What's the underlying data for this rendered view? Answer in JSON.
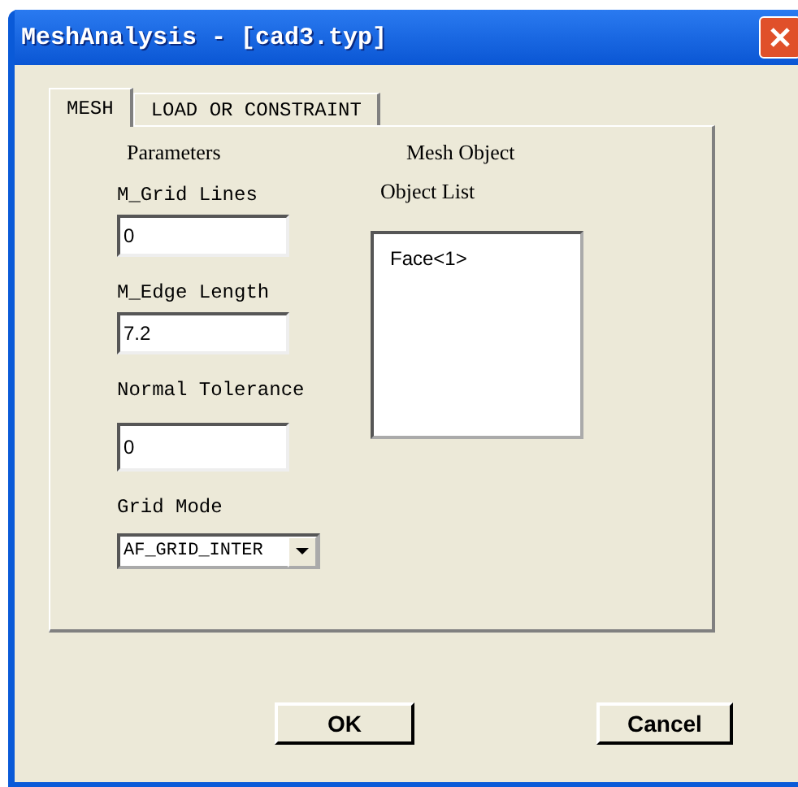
{
  "window": {
    "title": "MeshAnalysis - [cad3.typ]"
  },
  "tabs": [
    {
      "label": "MESH",
      "selected": true
    },
    {
      "label": "LOAD OR CONSTRAINT",
      "selected": false
    }
  ],
  "parameters": {
    "heading": "Parameters",
    "fields": [
      {
        "label": "M_Grid Lines",
        "value": "0"
      },
      {
        "label": "M_Edge Length",
        "value": "7.2"
      },
      {
        "label": "Normal Tolerance",
        "value": "0"
      }
    ],
    "grid_mode": {
      "label": "Grid Mode",
      "value": "AF_GRID_INTER"
    }
  },
  "mesh_object": {
    "heading": "Mesh Object",
    "list_label": "Object List",
    "items": [
      {
        "label": "Face<1>",
        "selected": false
      }
    ]
  },
  "buttons": [
    "OK",
    "Cancel"
  ]
}
